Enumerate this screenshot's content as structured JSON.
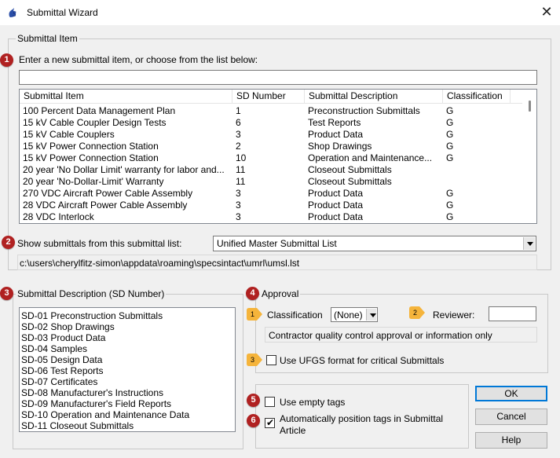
{
  "window": {
    "title": "Submittal Wizard",
    "close_glyph": "✕"
  },
  "submittal_item": {
    "group_label": "Submittal Item",
    "prompt": "Enter a new submittal item, or choose from the list below:",
    "input_value": "",
    "columns": [
      "Submittal Item",
      "SD Number",
      "Submittal Description",
      "Classification"
    ],
    "rows": [
      [
        "100 Percent Data Management Plan",
        "1",
        "Preconstruction Submittals",
        "G"
      ],
      [
        "15 kV Cable Coupler Design Tests",
        "6",
        "Test Reports",
        "G"
      ],
      [
        "15 kV Cable Couplers",
        "3",
        "Product Data",
        "G"
      ],
      [
        "15 kV Power Connection Station",
        "2",
        "Shop Drawings",
        "G"
      ],
      [
        "15 kV Power Connection Station",
        "10",
        "Operation and Maintenance...",
        "G"
      ],
      [
        "20 year 'No Dollar Limit' warranty for labor and...",
        "11",
        "Closeout Submittals",
        ""
      ],
      [
        "20 year 'No-Dollar-Limit' Warranty",
        "11",
        "Closeout Submittals",
        ""
      ],
      [
        "270 VDC Aircraft Power Cable Assembly",
        "3",
        "Product Data",
        "G"
      ],
      [
        "28 VDC Aircraft Power Cable Assembly",
        "3",
        "Product Data",
        "G"
      ],
      [
        "28 VDC Interlock",
        "3",
        "Product Data",
        "G"
      ]
    ],
    "show_list_label": "Show submittals from this submittal list:",
    "list_selected": "Unified Master Submittal List",
    "list_path": "c:\\users\\cherylfitz-simon\\appdata\\roaming\\specsintact\\umrl\\umsl.lst"
  },
  "sd_description": {
    "group_label": "Submittal Description (SD Number)",
    "items": [
      "SD-01 Preconstruction Submittals",
      "SD-02 Shop Drawings",
      "SD-03 Product Data",
      "SD-04 Samples",
      "SD-05 Design Data",
      "SD-06 Test Reports",
      "SD-07 Certificates",
      "SD-08 Manufacturer's Instructions",
      "SD-09 Manufacturer's Field Reports",
      "SD-10 Operation and Maintenance Data",
      "SD-11 Closeout Submittals"
    ]
  },
  "approval": {
    "group_label": "Approval",
    "classification_label": "Classification",
    "classification_value": "(None)",
    "reviewer_label": "Reviewer:",
    "reviewer_value": "",
    "info_text": "Contractor quality control approval or information only",
    "ufgs_label": "Use UFGS format for critical Submittals",
    "ufgs_checked": false
  },
  "tags": {
    "empty_tags_label": "Use empty tags",
    "empty_tags_checked": false,
    "auto_position_label_line1": "Automatically position tags in Submittal",
    "auto_position_label_line2": "Article",
    "auto_position_checked": true,
    "check_glyph": "✔"
  },
  "buttons": {
    "ok": "OK",
    "cancel": "Cancel",
    "help": "Help"
  },
  "callouts": {
    "red": [
      "1",
      "2",
      "3",
      "4",
      "5",
      "6"
    ],
    "orange": [
      "1",
      "2",
      "3"
    ],
    "red_color": "#b02121",
    "orange_color": "#f5b43b"
  }
}
